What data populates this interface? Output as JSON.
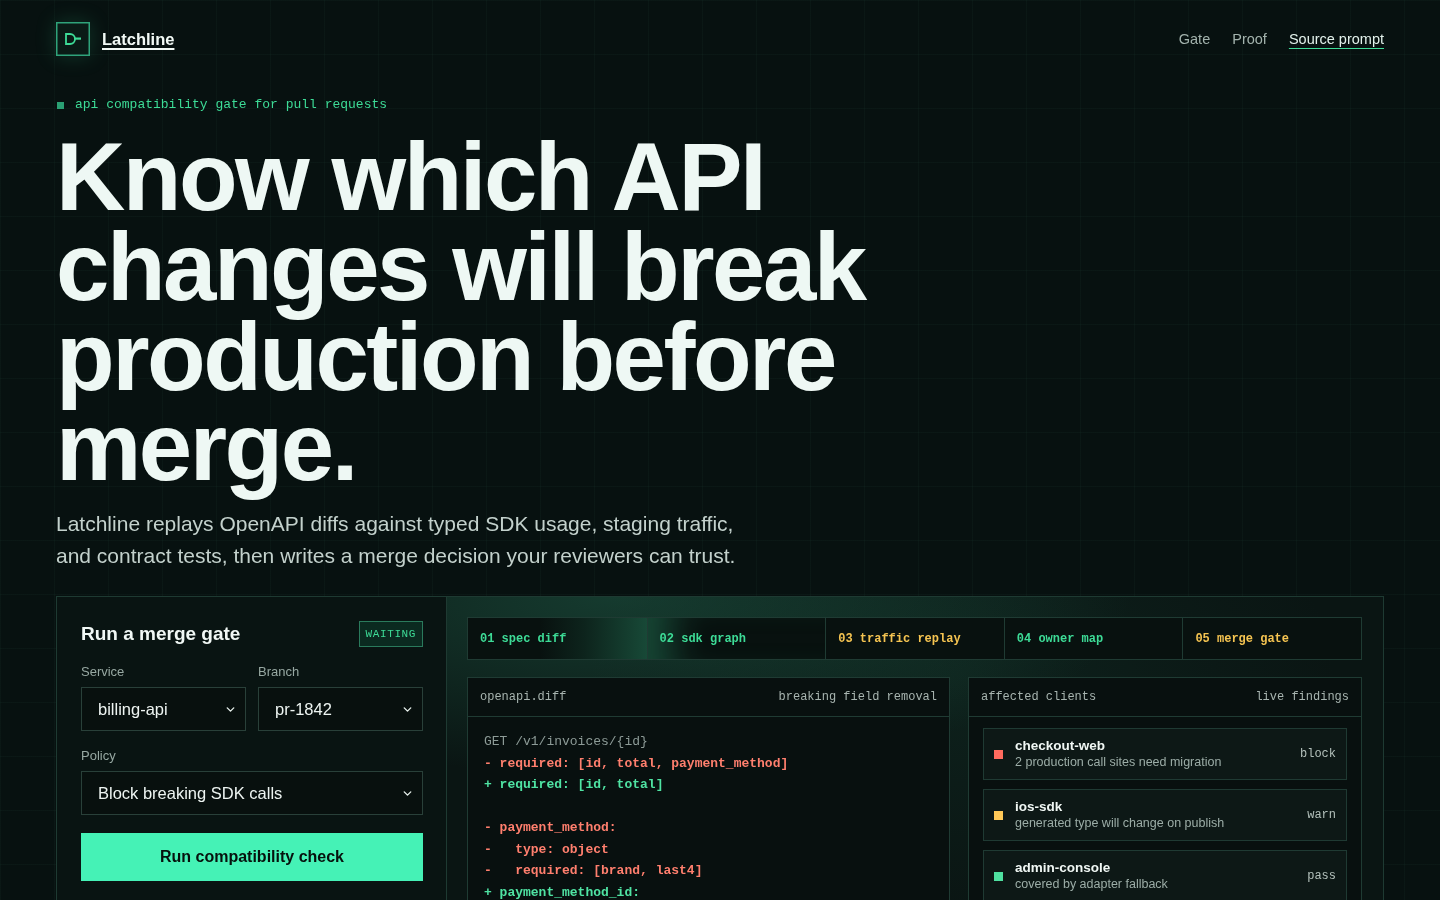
{
  "header": {
    "brand": "Latchline",
    "nav": [
      {
        "label": "Gate",
        "kind": "plain"
      },
      {
        "label": "Proof",
        "kind": "plain"
      },
      {
        "label": "Source prompt",
        "kind": "link"
      }
    ]
  },
  "hero": {
    "eyebrow": "api compatibility gate for pull requests",
    "headline": "Know which API changes will break production before merge.",
    "lede": "Latchline replays OpenAPI diffs against typed SDK usage, staging traffic, and contract tests, then writes a merge decision your reviewers can trust."
  },
  "gate_form": {
    "title": "Run a merge gate",
    "status": "WAITING",
    "field_rows": [
      [
        {
          "label": "Service",
          "value": "billing-api"
        },
        {
          "label": "Branch",
          "value": "pr-1842"
        }
      ],
      [
        {
          "label": "Policy",
          "value": "Block breaking SDK calls"
        }
      ]
    ],
    "button": "Run compatibility check"
  },
  "steps": [
    {
      "label": "01 spec diff",
      "kind": "ok",
      "selected": false
    },
    {
      "label": "02 sdk graph",
      "kind": "ok",
      "selected": true
    },
    {
      "label": "03 traffic replay",
      "kind": "warn",
      "selected": false
    },
    {
      "label": "04 owner map",
      "kind": "ok",
      "selected": false
    },
    {
      "label": "05 merge gate",
      "kind": "warn",
      "selected": false
    }
  ],
  "diff": {
    "file": "openapi.diff",
    "summary": "breaking field removal",
    "lines": [
      {
        "kind": "context",
        "text": "GET /v1/invoices/{id}"
      },
      {
        "kind": "removed",
        "text": "- required: [id, total, payment_method]"
      },
      {
        "kind": "added",
        "text": "+ required: [id, total]"
      },
      {
        "kind": "blank"
      },
      {
        "kind": "removed",
        "text": "- payment_method:"
      },
      {
        "kind": "removed",
        "text": "-   type: object"
      },
      {
        "kind": "removed",
        "text": "-   required: [brand, last4]"
      },
      {
        "kind": "added",
        "text": "+ payment_method_id:"
      }
    ]
  },
  "clients": {
    "title": "affected clients",
    "caption": "live findings",
    "items": [
      {
        "name": "checkout-web",
        "detail": "2 production call sites need migration",
        "verdict": "block",
        "color": "#ff6b5e"
      },
      {
        "name": "ios-sdk",
        "detail": "generated type will change on publish",
        "verdict": "warn",
        "color": "#ffc857"
      },
      {
        "name": "admin-console",
        "detail": "covered by adapter fallback",
        "verdict": "pass",
        "color": "#4fe0a0"
      }
    ]
  }
}
